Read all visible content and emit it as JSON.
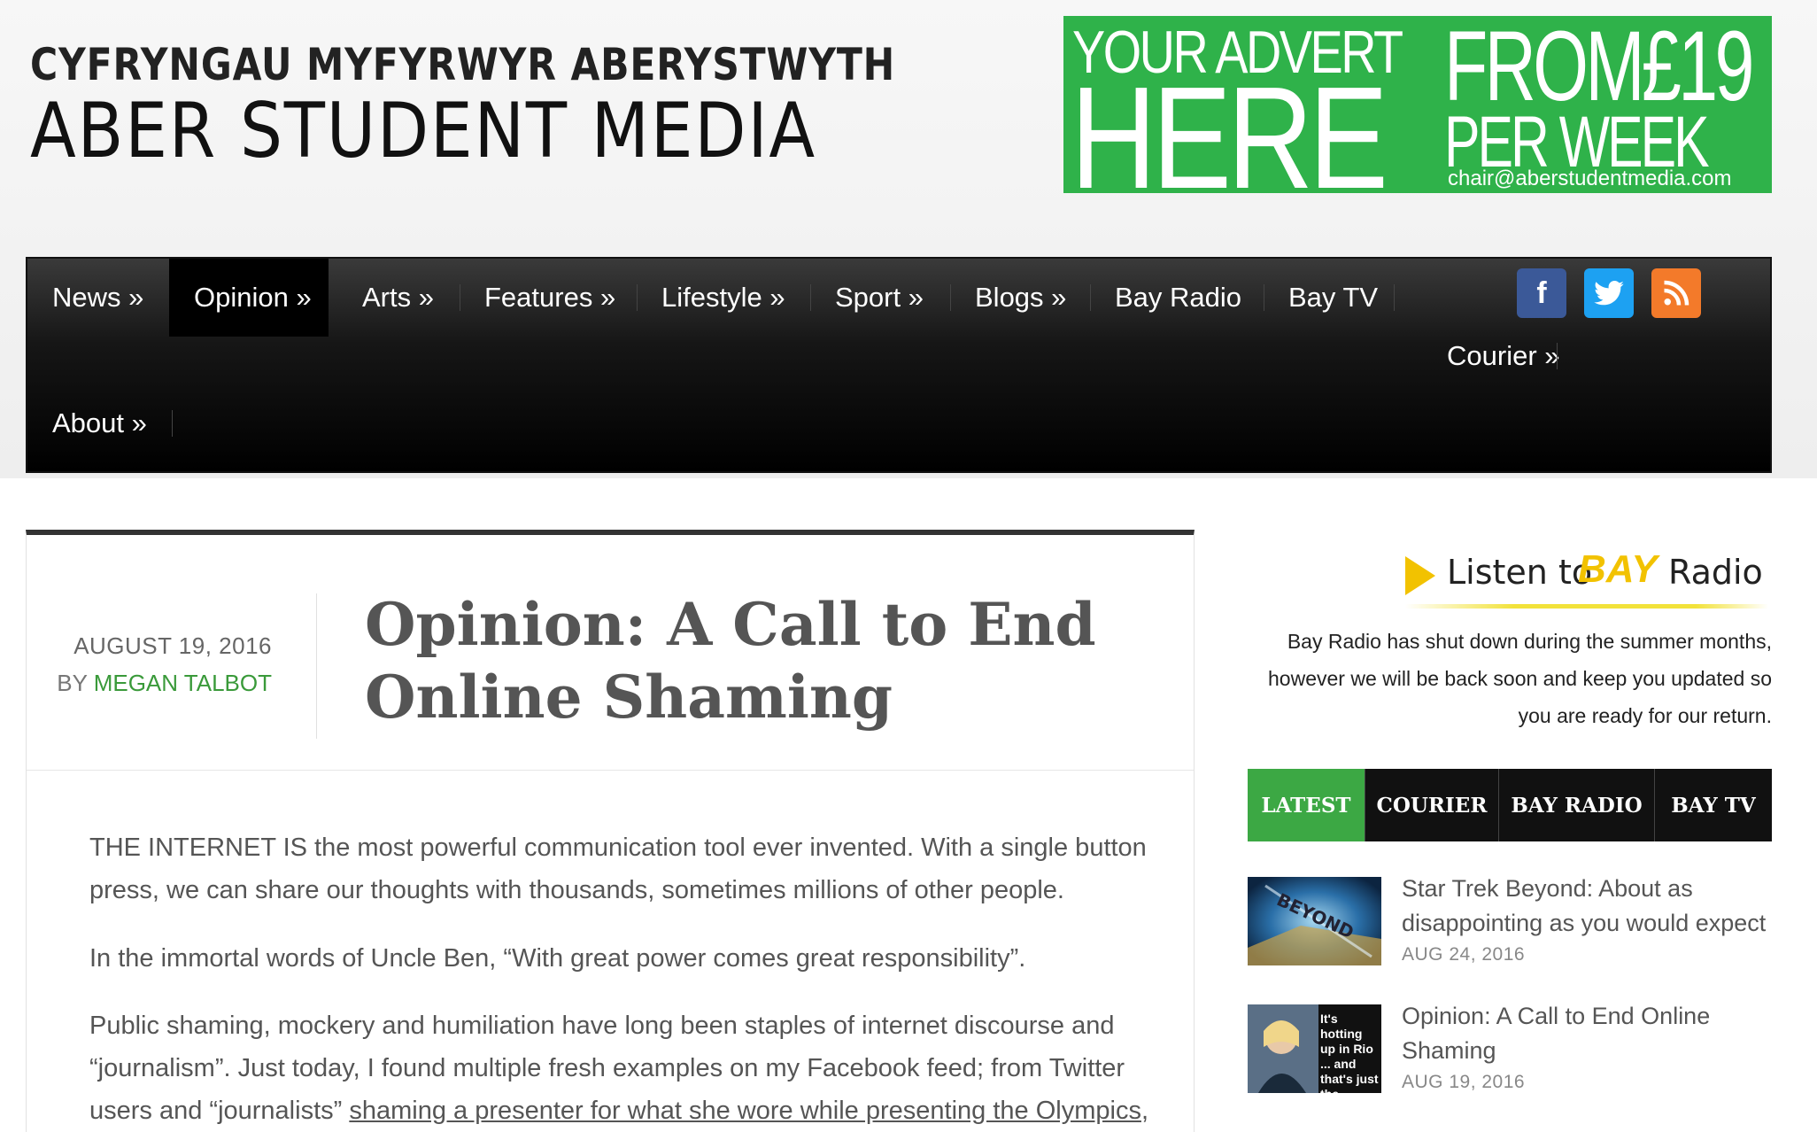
{
  "header": {
    "welsh_title": "CYFRYNGAU MYFYRWYR ABERYSTWYTH",
    "site_title": "ABER STUDENT MEDIA"
  },
  "advert": {
    "line1": "YOUR ADVERT",
    "line2": "HERE",
    "line3": "FROM£19",
    "line4": "PER WEEK",
    "email": "chair@aberstudentmedia.com",
    "color": "#2fb24a"
  },
  "nav": {
    "items": [
      {
        "label": "News »"
      },
      {
        "label": "Opinion »"
      },
      {
        "label": "Arts »"
      },
      {
        "label": "Features »"
      },
      {
        "label": "Lifestyle »"
      },
      {
        "label": "Sport »"
      },
      {
        "label": "Blogs »"
      },
      {
        "label": "Bay Radio"
      },
      {
        "label": "Bay TV"
      },
      {
        "label": "Courier »"
      },
      {
        "label": "About »"
      }
    ],
    "active": "Opinion »",
    "social": {
      "facebook": "f",
      "twitter": "twitter-bird-icon",
      "rss": "rss-icon"
    }
  },
  "article": {
    "date": "AUGUST 19, 2016",
    "by": "BY",
    "author": "MEGAN TALBOT",
    "title": "Opinion: A Call to End Online Shaming",
    "paragraphs": [
      "THE INTERNET IS the most powerful communication tool ever invented. With a single button press, we can share our thoughts with thousands, sometimes millions of other people.",
      "In the immortal words of Uncle Ben, “With great power comes great responsibility”."
    ],
    "para3_start": "Public shaming, mockery and humiliation have long been staples of internet discourse and “journalism”. Just today, I found multiple fresh examples on my Facebook feed; from Twitter users and “journalists” ",
    "para3_link": "shaming a presenter for what she wore while presenting the Olympics",
    "para3_end": ","
  },
  "sidebar": {
    "radio_logo": {
      "listen": "Listen to",
      "bay": "BAY",
      "radio": "Radio"
    },
    "radio_note": "Bay Radio has shut down during the summer months, however we will be back soon and keep you updated so you are ready for our return.",
    "tabs": [
      "LATEST",
      "COURIER",
      "BAY RADIO",
      "BAY TV"
    ],
    "posts": [
      {
        "title": "Star Trek Beyond: About as disappointing as you would expect",
        "date": "AUG 24, 2016",
        "thumb_text": "BEYOND"
      },
      {
        "title": "Opinion: A Call to End Online Shaming",
        "date": "AUG 19, 2016",
        "thumb_text": "It's hotting up in Rio ... and that's just the"
      }
    ]
  }
}
